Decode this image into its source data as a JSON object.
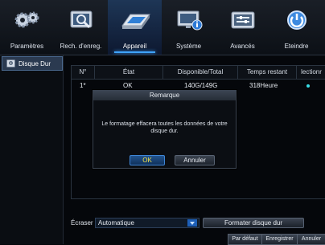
{
  "nav": {
    "items": [
      {
        "label": "Paramètres",
        "icon": "gears-icon"
      },
      {
        "label": "Rech. d'enreg.",
        "icon": "search-video-icon"
      },
      {
        "label": "Appareil",
        "icon": "hard-disk-icon"
      },
      {
        "label": "Système",
        "icon": "monitor-info-icon"
      },
      {
        "label": "Avancés",
        "icon": "advanced-icon"
      },
      {
        "label": "Eteindre",
        "icon": "power-icon"
      }
    ],
    "active_index": 2,
    "accent_color": "#3fa3ff"
  },
  "sidebar": {
    "items": [
      {
        "label": "Disque Dur",
        "icon": "hard-disk-small-icon"
      }
    ]
  },
  "table": {
    "headers": [
      "N°",
      "État",
      "Disponible/Total",
      "Temps restant",
      "lectionr"
    ],
    "rows": [
      {
        "no": "1*",
        "state": "OK",
        "capacity": "140G/149G",
        "remaining": "318Heure",
        "selected_color": "#39e0e8"
      }
    ]
  },
  "dialog": {
    "title": "Remarque",
    "message": "Le formatage effacera toutes les données de votre disque dur.",
    "ok_label": "OK",
    "cancel_label": "Annuler"
  },
  "controls": {
    "overwrite_label": "Écraser",
    "overwrite_value": "Automatique",
    "format_label": "Formater disque dur"
  },
  "footer": {
    "default_label": "Par défaut",
    "save_label": "Enregistrer",
    "cancel_label": "Annuler"
  }
}
